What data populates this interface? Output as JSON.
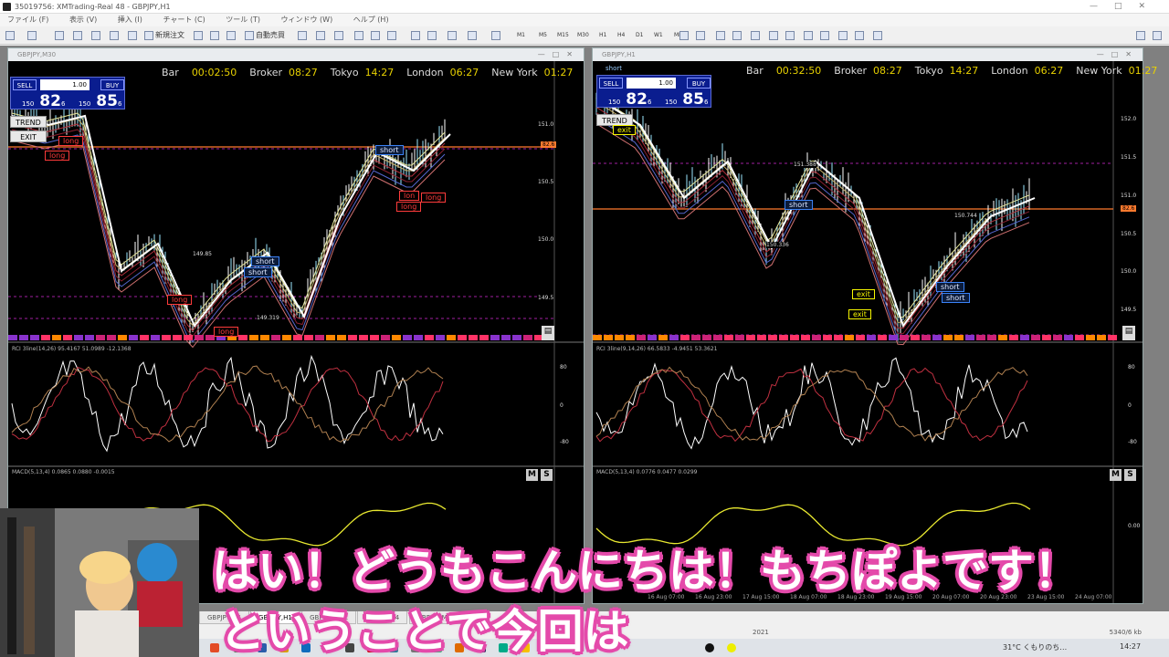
{
  "window": {
    "title": "35019756: XMTrading-Real 48 - GBPJPY,H1"
  },
  "menu": [
    "ファイル (F)",
    "表示 (V)",
    "挿入 (I)",
    "チャート (C)",
    "ツール (T)",
    "ウィンドウ (W)",
    "ヘルプ (H)"
  ],
  "toolbar": {
    "new_order": "新規注文",
    "auto_trade": "自動売買",
    "timeframes": [
      "M1",
      "M5",
      "M15",
      "M30",
      "H1",
      "H4",
      "D1",
      "W1",
      "MN"
    ]
  },
  "session": {
    "bar_label": "Bar",
    "broker_label": "Broker",
    "broker_time": "08:27",
    "tokyo_label": "Tokyo",
    "tokyo_time": "14:27",
    "london_label": "London",
    "london_time": "06:27",
    "ny_label": "New York",
    "ny_time": "01:27"
  },
  "trade_panel": {
    "sell": "SELL",
    "buy": "BUY",
    "lot": "1.00",
    "bid_prefix": "150",
    "bid_main": "82",
    "bid_sup": "6",
    "ask_prefix": "150",
    "ask_main": "85",
    "ask_sup": "6"
  },
  "left_chart": {
    "title": "GBPJPY,M30",
    "bar_timer": "00:02:50",
    "trend_btn": "TREND",
    "exit_btn": "EXIT",
    "price_marker": "82.6",
    "rci_label": "RCI 3line(14,26) 95.4167 51.0989 -12.1368",
    "macd_label": "MACD(5,13,4) 0.0865 0.0880 -0.0015",
    "price_labels": [
      "151.0",
      "150.5",
      "150.0",
      "149.5"
    ],
    "rci_levels": [
      "80",
      "0",
      "-80"
    ],
    "swing_labels": [
      "149.85",
      "149.319"
    ],
    "labels_long": [
      "long",
      "long",
      "long",
      "long",
      "lon",
      "long",
      "long"
    ],
    "labels_short": [
      "short",
      "short",
      "short"
    ]
  },
  "right_chart": {
    "title": "GBPJPY,H1",
    "header_text": "short",
    "bar_timer": "00:32:50",
    "trend_btn": "TREND",
    "exit_label": "exit",
    "price_marker": "82.6",
    "rci_label": "RCI 3line(9,14,26) 66.5833 -4.9451 53.3621",
    "macd_label": "MACD(5,13,4) 0.0776 0.0477 0.0299",
    "price_labels": [
      "152.0",
      "151.5",
      "151.0",
      "150.5",
      "150.0",
      "149.5"
    ],
    "rci_levels": [
      "80",
      "0",
      "-80"
    ],
    "macd_levels": [
      "0.00"
    ],
    "swing_labels": [
      "151.388",
      "150.336",
      "150.744"
    ],
    "labels_short": [
      "short",
      "short",
      "short"
    ],
    "labels_exit": [
      "exit",
      "exit"
    ],
    "x_dates": [
      "16 Aug 07:00",
      "16 Aug 23:00",
      "17 Aug 15:00",
      "18 Aug 07:00",
      "18 Aug 23:00",
      "19 Aug 15:00",
      "20 Aug 07:00",
      "20 Aug 23:00",
      "23 Aug 15:00",
      "24 Aug 07:00"
    ]
  },
  "tabs": [
    "GBPJPY,H4",
    "GBPJPY,H1",
    "GBPUSD,M1",
    "GBPJPY,H4",
    "GBPJPY,M30"
  ],
  "status": {
    "year": "2021",
    "memory": "5340/6 kb"
  },
  "taskbar": {
    "weather": "31°C くもりのち…",
    "clock": "14:27"
  },
  "subtitle": {
    "line1": "はい！どうもこんにちは！もちぽよです！",
    "line2": "ということで今回は"
  },
  "colors": {
    "price_line": "#ff7a2e",
    "bull": "#9be7ff",
    "bear": "#ffffff",
    "ma_yellow": "#e8e89a",
    "ma_red": "#b0303a",
    "macd": "#e8e830",
    "subtitle_outline": "#e44aaa"
  }
}
